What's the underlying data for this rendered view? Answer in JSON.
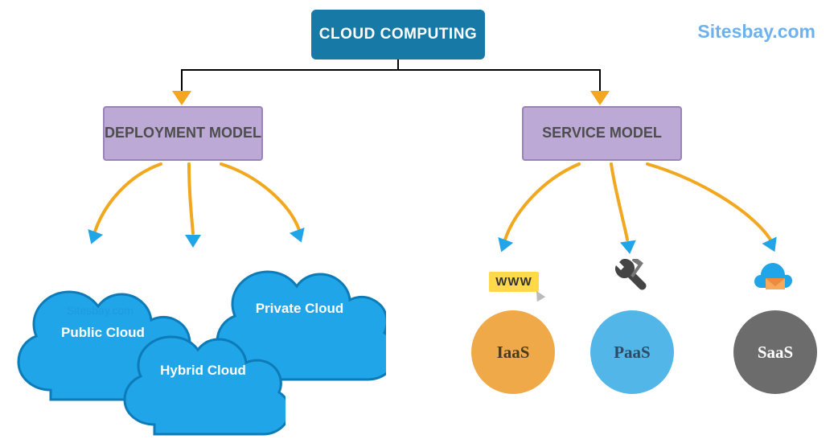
{
  "root": {
    "title": "CLOUD COMPUTING"
  },
  "watermark": "Sitesbay.com",
  "sub_watermark": "Sitesbay.com",
  "branches": {
    "deployment": {
      "label": "DEPLOYMENT MODEL"
    },
    "service": {
      "label": "SERVICE MODEL"
    }
  },
  "deployment_children": {
    "public": {
      "label": "Public Cloud"
    },
    "hybrid": {
      "label": "Hybrid Cloud"
    },
    "private": {
      "label": "Private Cloud"
    }
  },
  "service_children": {
    "iaas": {
      "label": "IaaS",
      "icon": "www-icon",
      "icon_text": "WWW"
    },
    "paas": {
      "label": "PaaS",
      "icon": "tools-icon"
    },
    "saas": {
      "label": "SaaS",
      "icon": "cloud-mail-icon"
    }
  },
  "colors": {
    "root_bg": "#177aa6",
    "branch_bg": "#bda9d6",
    "arrow_orange": "#f1a81f",
    "arrow_tip_blue": "#1fa5e8",
    "cloud_fill": "#1fa5e8",
    "iaas": "#f0a948",
    "paas": "#53b6e8",
    "saas": "#6c6c6c"
  }
}
